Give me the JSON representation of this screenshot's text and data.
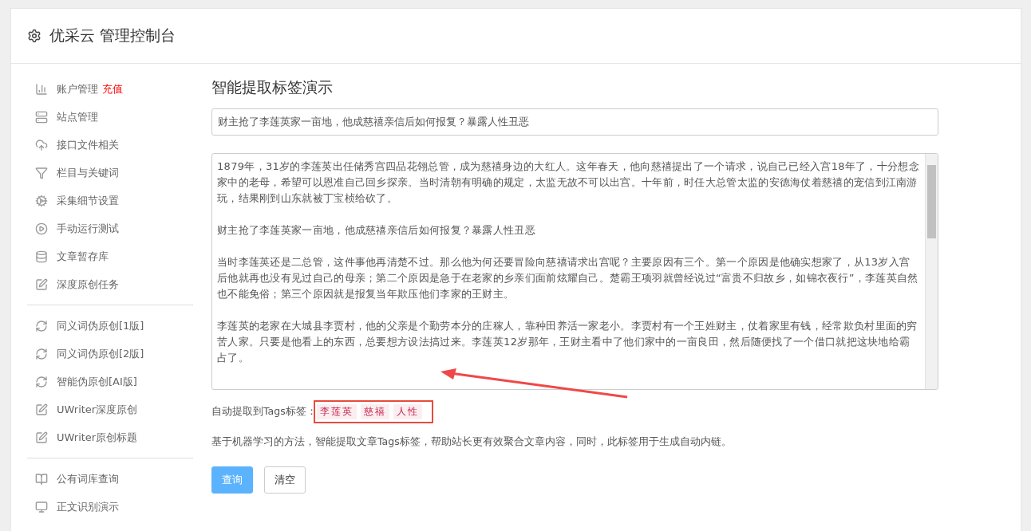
{
  "header": {
    "title": "优采云 管理控制台"
  },
  "sidebar": {
    "groups": [
      [
        {
          "kind": "chart",
          "label": "账户管理",
          "badge": "充值"
        },
        {
          "kind": "server",
          "label": "站点管理"
        },
        {
          "kind": "cloud",
          "label": "接口文件相关"
        },
        {
          "kind": "filter",
          "label": "栏目与关键词"
        },
        {
          "kind": "cogs",
          "label": "采集细节设置"
        },
        {
          "kind": "play",
          "label": "手动运行测试"
        },
        {
          "kind": "database",
          "label": "文章暂存库"
        },
        {
          "kind": "edit",
          "label": "深度原创任务"
        }
      ],
      [
        {
          "kind": "refresh",
          "label": "同义词伪原创[1版]"
        },
        {
          "kind": "refresh",
          "label": "同义词伪原创[2版]"
        },
        {
          "kind": "refresh",
          "label": "智能伪原创[AI版]"
        },
        {
          "kind": "edit",
          "label": "UWriter深度原创"
        },
        {
          "kind": "edit",
          "label": "UWriter原创标题"
        }
      ],
      [
        {
          "kind": "book",
          "label": "公有词库查询"
        },
        {
          "kind": "monitor",
          "label": "正文识别演示"
        }
      ]
    ]
  },
  "main": {
    "title": "智能提取标签演示",
    "title_field": {
      "value": "财主抢了李莲英家一亩地，他成慈禧亲信后如何报复？暴露人性丑恶"
    },
    "content_paragraphs": [
      "1879年，31岁的李莲英出任储秀宫四品花翎总管，成为慈禧身边的大红人。这年春天，他向慈禧提出了一个请求，说自己已经入宫18年了，十分想念家中的老母，希望可以恩准自己回乡探亲。当时清朝有明确的规定，太监无故不可以出宫。十年前，时任大总管太监的安德海仗着慈禧的宠信到江南游玩，结果刚到山东就被丁宝桢给砍了。",
      "财主抢了李莲英家一亩地，他成慈禧亲信后如何报复？暴露人性丑恶",
      "当时李莲英还是二总管，这件事他再清楚不过。那么他为何还要冒险向慈禧请求出宫呢？主要原因有三个。第一个原因是他确实想家了，从13岁入宫后他就再也没有见过自己的母亲；第二个原因是急于在老家的乡亲们面前炫耀自己。楚霸王项羽就曾经说过“富贵不归故乡，如锦衣夜行”，李莲英自然也不能免俗；第三个原因就是报复当年欺压他们李家的王财主。",
      "李莲英的老家在大城县李贾村，他的父亲是个勤劳本分的庄稼人，靠种田养活一家老小。李贾村有一个王姓财主，仗着家里有钱，经常欺负村里面的穷苦人家。只要是他看上的东西，总要想方设法搞过来。李莲英12岁那年，王财主看中了他们家中的一亩良田，然后随便找了一个借口就把这块地给霸占了。"
    ],
    "tags_label": "自动提取到Tags标签：",
    "tags": [
      "李莲英",
      "慈禧",
      "人性"
    ],
    "description": "基于机器学习的方法，智能提取文章Tags标签，帮助站长更有效聚合文章内容，同时，此标签用于生成自动内链。",
    "buttons": [
      {
        "label": "查询",
        "kind": "primary"
      },
      {
        "label": "清空",
        "kind": "default"
      }
    ]
  }
}
